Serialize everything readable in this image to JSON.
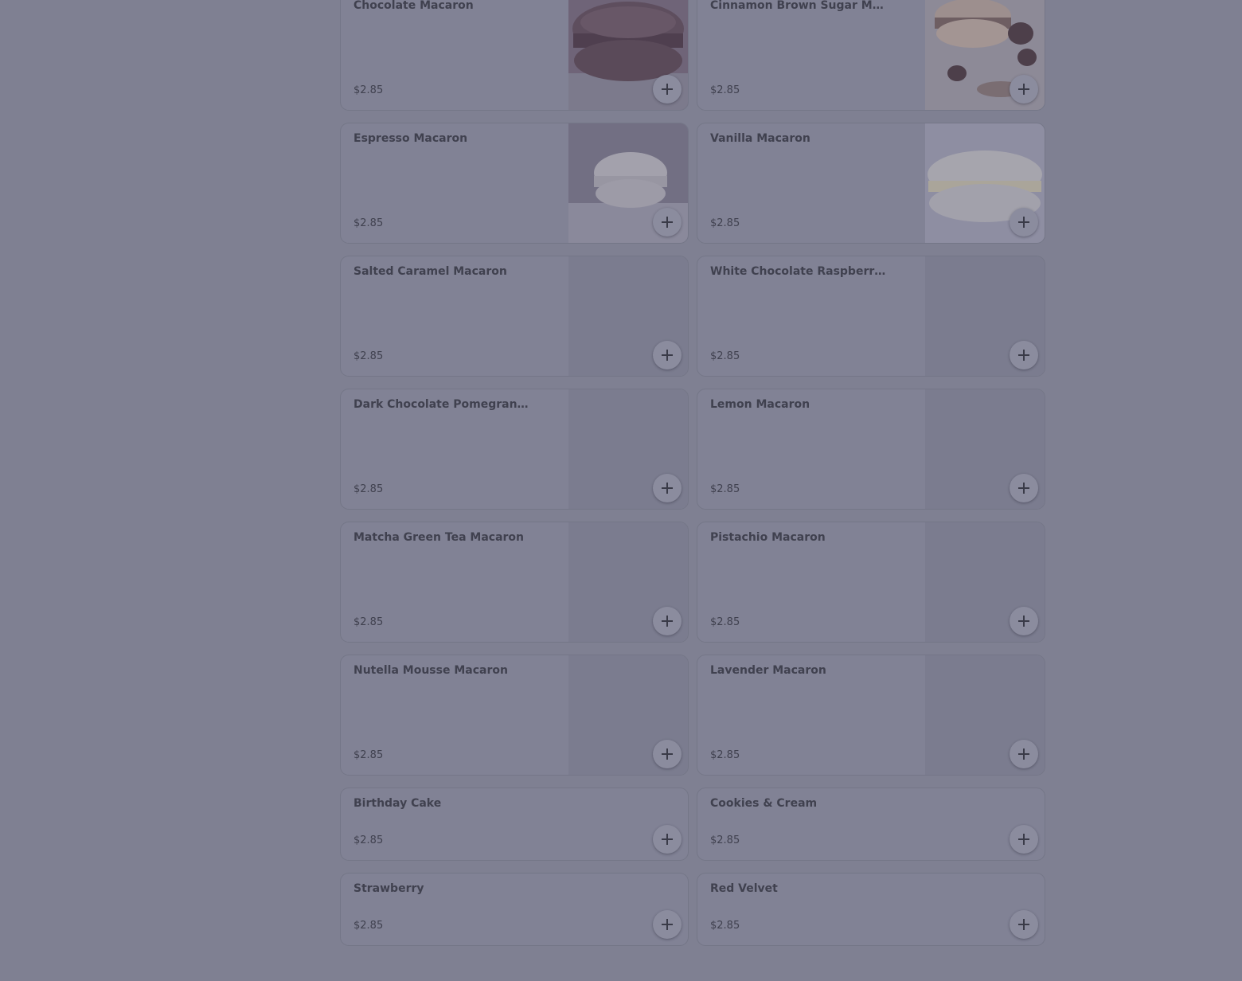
{
  "menu": {
    "items": [
      {
        "name": "Chocolate Macaron",
        "price": "$2.85",
        "image": "chocolate-macaron-photo"
      },
      {
        "name": "Cinnamon Brown Sugar Macaron",
        "price": "$2.85",
        "image": "cinnamon-macaron-photo"
      },
      {
        "name": "Espresso Macaron",
        "price": "$2.85",
        "image": "espresso-macaron-photo"
      },
      {
        "name": "Vanilla Macaron",
        "price": "$2.85",
        "image": "vanilla-macaron-photo"
      },
      {
        "name": "Salted Caramel Macaron",
        "price": "$2.85",
        "image": "placeholder"
      },
      {
        "name": "White Chocolate Raspberry Ma...",
        "price": "$2.85",
        "image": "placeholder"
      },
      {
        "name": "Dark Chocolate Pomegranate ...",
        "price": "$2.85",
        "image": "placeholder"
      },
      {
        "name": "Lemon Macaron",
        "price": "$2.85",
        "image": "placeholder"
      },
      {
        "name": "Matcha Green Tea Macaron",
        "price": "$2.85",
        "image": "placeholder"
      },
      {
        "name": "Pistachio Macaron",
        "price": "$2.85",
        "image": "placeholder"
      },
      {
        "name": "Nutella Mousse Macaron",
        "price": "$2.85",
        "image": "placeholder"
      },
      {
        "name": "Lavender Macaron",
        "price": "$2.85",
        "image": "placeholder"
      },
      {
        "name": "Birthday Cake",
        "price": "$2.85",
        "image": ""
      },
      {
        "name": "Cookies & Cream",
        "price": "$2.85",
        "image": ""
      },
      {
        "name": "Strawberry",
        "price": "$2.85",
        "image": ""
      },
      {
        "name": "Red Velvet",
        "price": "$2.85",
        "image": ""
      }
    ],
    "add_icon": "plus-icon"
  },
  "colors": {
    "overlay": "#7f8092",
    "card": "#818295",
    "text": "#40414f"
  }
}
